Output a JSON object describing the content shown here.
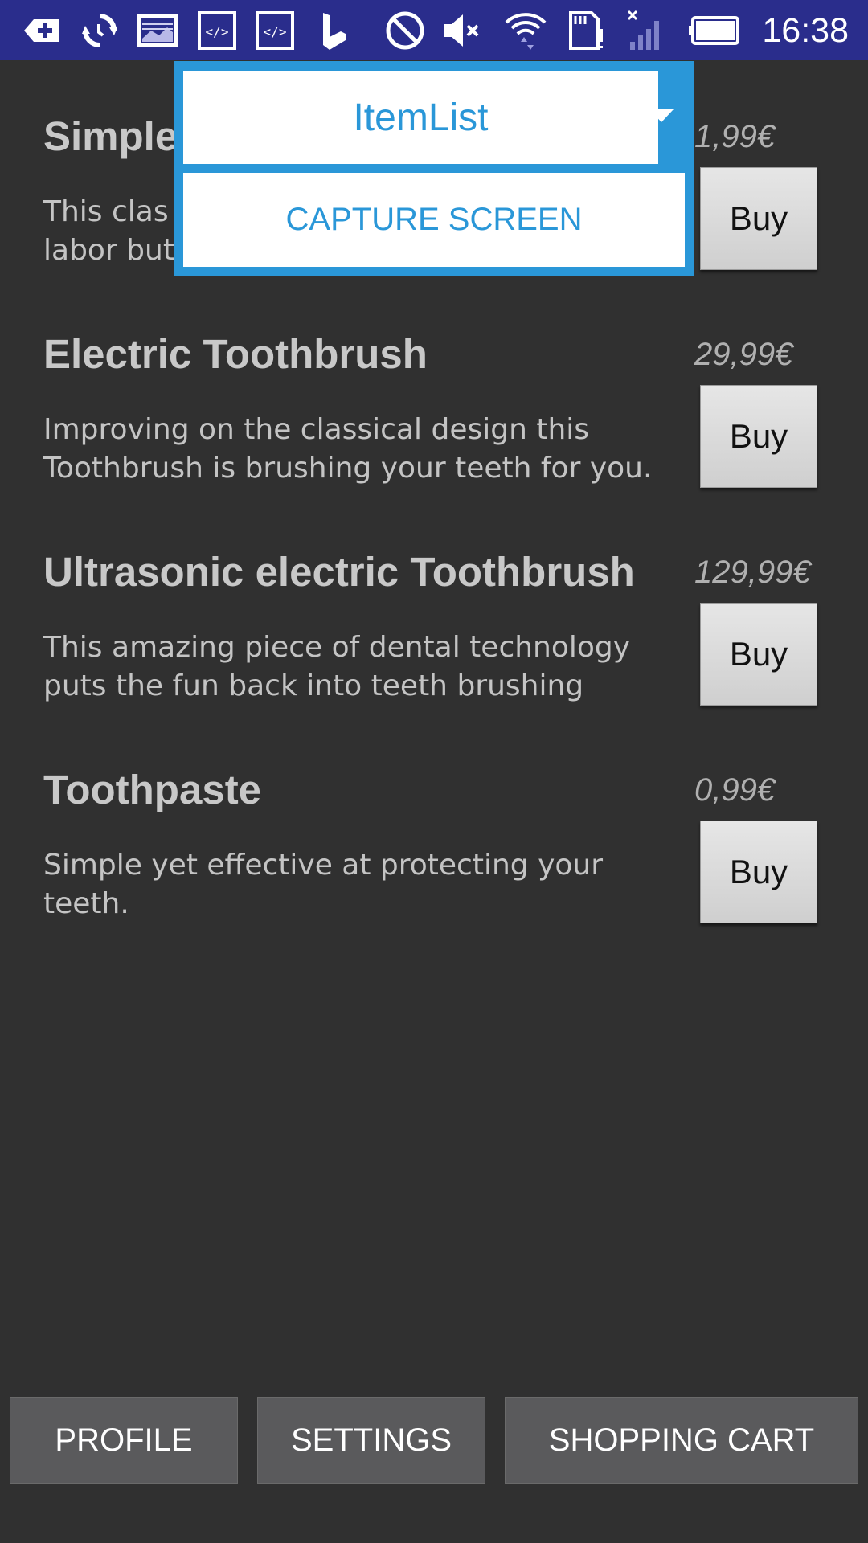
{
  "status_bar": {
    "time": "16:38",
    "icons": [
      "add-icon",
      "sync-icon",
      "image-icon",
      "code-icon",
      "code-icon",
      "bing-icon",
      "do-not-disturb-icon",
      "mute-icon",
      "wifi-icon",
      "sd-card-alert-icon",
      "no-signal-icon",
      "battery-icon"
    ]
  },
  "overlay": {
    "selected": "ItemList",
    "capture_label": "CAPTURE SCREEN"
  },
  "products": [
    {
      "name": "Simple",
      "price": "1,99€",
      "description": "This clas\nlabor but",
      "buy_label": "Buy"
    },
    {
      "name": "Electric Toothbrush",
      "price": "29,99€",
      "description": "Improving on the classical design this Toothbrush is brushing your teeth for you.",
      "buy_label": "Buy"
    },
    {
      "name": "Ultrasonic electric Toothbrush",
      "price": "129,99€",
      "description": "This amazing piece of dental technology puts the fun back into teeth brushing",
      "buy_label": "Buy"
    },
    {
      "name": "Toothpaste",
      "price": "0,99€",
      "description": "Simple yet effective at protecting your teeth.",
      "buy_label": "Buy"
    }
  ],
  "bottom_nav": {
    "profile": "PROFILE",
    "settings": "SETTINGS",
    "cart": "SHOPPING CART"
  },
  "colors": {
    "background": "#303030",
    "status_bar": "#2a2d8c",
    "accent": "#2a97d8",
    "nav_button": "#5a5a5c"
  }
}
